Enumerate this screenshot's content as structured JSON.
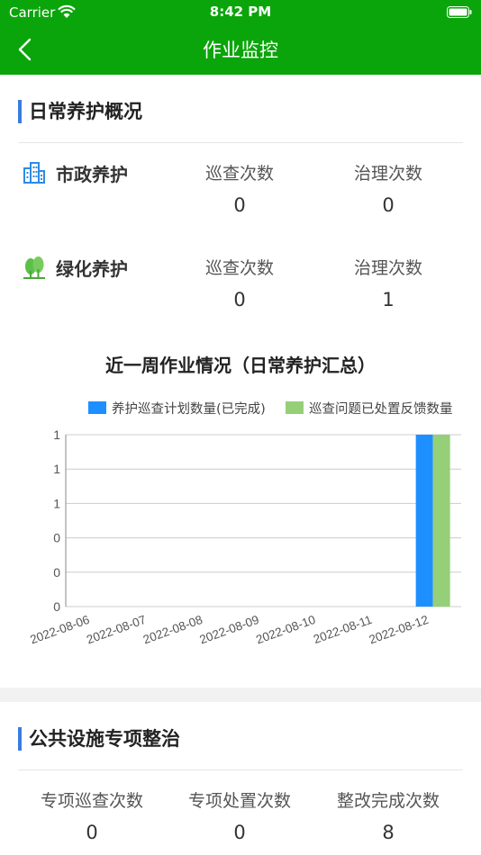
{
  "status_bar": {
    "carrier": "Carrier",
    "time": "8:42 PM"
  },
  "nav": {
    "title": "作业监控",
    "back_icon": "chevron-left-icon"
  },
  "daily": {
    "title": "日常养护概况",
    "rows": [
      {
        "name": "市政养护",
        "icon": "building-icon",
        "label1": "巡查次数",
        "value1": "0",
        "label2": "治理次数",
        "value2": "0"
      },
      {
        "name": "绿化养护",
        "icon": "tree-icon",
        "label1": "巡查次数",
        "value1": "0",
        "label2": "治理次数",
        "value2": "1"
      }
    ]
  },
  "chart_title": "近一周作业情况（日常养护汇总）",
  "chart_data": {
    "type": "bar",
    "categories": [
      "2022-08-06",
      "2022-08-07",
      "2022-08-08",
      "2022-08-09",
      "2022-08-10",
      "2022-08-11",
      "2022-08-12"
    ],
    "series": [
      {
        "name": "养护巡查计划数量(已完成)",
        "color": "#1e8fff",
        "values": [
          0,
          0,
          0,
          0,
          0,
          0,
          1
        ]
      },
      {
        "name": "巡查问题已处置反馈数量",
        "color": "#95cf78",
        "values": [
          0,
          0,
          0,
          0,
          0,
          0,
          1
        ]
      }
    ],
    "ylim": [
      0,
      1
    ],
    "y_tick_labels": [
      "0",
      "0",
      "0",
      "1",
      "1",
      "1"
    ],
    "grid": true,
    "legend": "top"
  },
  "special": {
    "title": "公共设施专项整治",
    "stats": [
      {
        "label": "专项巡查次数",
        "value": "0"
      },
      {
        "label": "专项处置次数",
        "value": "0"
      },
      {
        "label": "整改完成次数",
        "value": "8"
      }
    ]
  },
  "colors": {
    "nav_bg": "#0aa50a",
    "accent": "#3a7be0"
  }
}
